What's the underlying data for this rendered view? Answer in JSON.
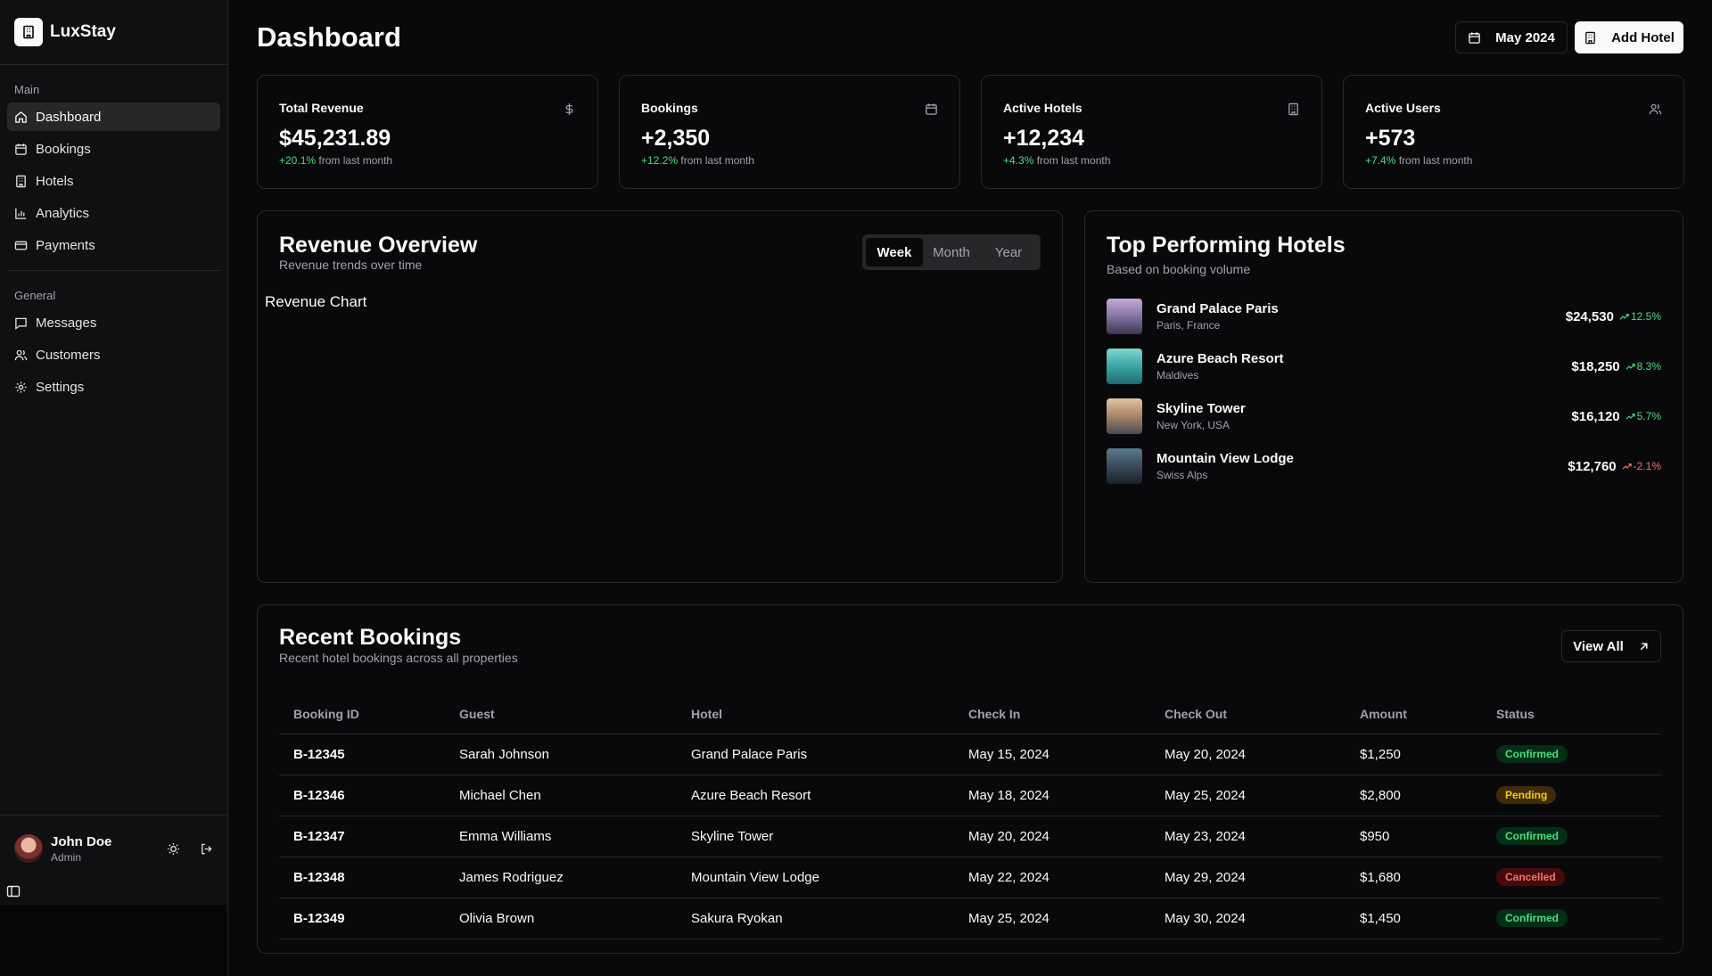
{
  "sidebar": {
    "brand": "LuxStay",
    "main_label": "Main",
    "main_items": [
      {
        "label": "Dashboard",
        "icon": "home-icon",
        "active": true
      },
      {
        "label": "Bookings",
        "icon": "calendar-icon"
      },
      {
        "label": "Hotels",
        "icon": "building-icon"
      },
      {
        "label": "Analytics",
        "icon": "bar-chart-icon"
      },
      {
        "label": "Payments",
        "icon": "credit-card-icon"
      }
    ],
    "general_label": "General",
    "general_items": [
      {
        "label": "Messages",
        "icon": "message-icon"
      },
      {
        "label": "Customers",
        "icon": "users-icon"
      },
      {
        "label": "Settings",
        "icon": "gear-icon"
      }
    ],
    "user": {
      "name": "John Doe",
      "role": "Admin"
    }
  },
  "header": {
    "title": "Dashboard",
    "date_button": "May 2024",
    "add_button": "Add Hotel"
  },
  "stats": [
    {
      "title": "Total Revenue",
      "value": "$45,231.89",
      "change": "+20.1%",
      "suffix": "from last month",
      "icon": "dollar-icon"
    },
    {
      "title": "Bookings",
      "value": "+2,350",
      "change": "+12.2%",
      "suffix": "from last month",
      "icon": "calendar-icon"
    },
    {
      "title": "Active Hotels",
      "value": "+12,234",
      "change": "+4.3%",
      "suffix": "from last month",
      "icon": "building-icon"
    },
    {
      "title": "Active Users",
      "value": "+573",
      "change": "+7.4%",
      "suffix": "from last month",
      "icon": "users-icon"
    }
  ],
  "revenue": {
    "title": "Revenue Overview",
    "subtitle": "Revenue trends over time",
    "tabs": [
      "Week",
      "Month",
      "Year"
    ],
    "active_tab": "Week",
    "placeholder": "Revenue Chart"
  },
  "top_hotels": {
    "title": "Top Performing Hotels",
    "subtitle": "Based on booking volume",
    "items": [
      {
        "name": "Grand Palace Paris",
        "location": "Paris, France",
        "amount": "$24,530",
        "trend": "12.5%",
        "direction": "up",
        "thumb": "#8a7aa8"
      },
      {
        "name": "Azure Beach Resort",
        "location": "Maldives",
        "amount": "$18,250",
        "trend": "8.3%",
        "direction": "up",
        "thumb": "#3aa6a6"
      },
      {
        "name": "Skyline Tower",
        "location": "New York, USA",
        "amount": "$16,120",
        "trend": "5.7%",
        "direction": "up",
        "thumb": "#b08a6a"
      },
      {
        "name": "Mountain View Lodge",
        "location": "Swiss Alps",
        "amount": "$12,760",
        "trend": "-2.1%",
        "direction": "down",
        "thumb": "#3a4a5a"
      }
    ]
  },
  "recent_bookings": {
    "title": "Recent Bookings",
    "subtitle": "Recent hotel bookings across all properties",
    "view_all": "View All",
    "columns": [
      "Booking ID",
      "Guest",
      "Hotel",
      "Check In",
      "Check Out",
      "Amount",
      "Status"
    ],
    "rows": [
      {
        "id": "B-12345",
        "guest": "Sarah Johnson",
        "hotel": "Grand Palace Paris",
        "check_in": "May 15, 2024",
        "check_out": "May 20, 2024",
        "amount": "$1,250",
        "status": "Confirmed"
      },
      {
        "id": "B-12346",
        "guest": "Michael Chen",
        "hotel": "Azure Beach Resort",
        "check_in": "May 18, 2024",
        "check_out": "May 25, 2024",
        "amount": "$2,800",
        "status": "Pending"
      },
      {
        "id": "B-12347",
        "guest": "Emma Williams",
        "hotel": "Skyline Tower",
        "check_in": "May 20, 2024",
        "check_out": "May 23, 2024",
        "amount": "$950",
        "status": "Confirmed"
      },
      {
        "id": "B-12348",
        "guest": "James Rodriguez",
        "hotel": "Mountain View Lodge",
        "check_in": "May 22, 2024",
        "check_out": "May 29, 2024",
        "amount": "$1,680",
        "status": "Cancelled"
      },
      {
        "id": "B-12349",
        "guest": "Olivia Brown",
        "hotel": "Sakura Ryokan",
        "check_in": "May 25, 2024",
        "check_out": "May 30, 2024",
        "amount": "$1,450",
        "status": "Confirmed"
      }
    ]
  },
  "colors": {
    "positive": "#4ade80",
    "negative": "#f87171",
    "pending": "#facc15"
  }
}
